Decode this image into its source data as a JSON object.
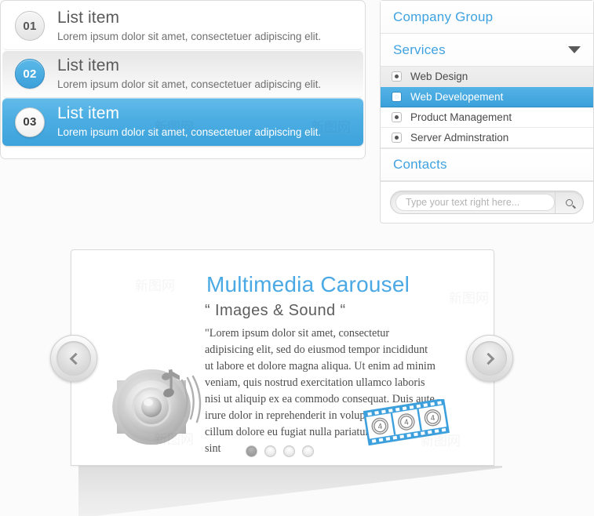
{
  "list_panel": {
    "items": [
      {
        "number": "01",
        "title": "List item",
        "description": "Lorem ipsum dolor sit amet, consectetuer adipiscing elit.",
        "state": "plain"
      },
      {
        "number": "02",
        "title": "List item",
        "description": "Lorem ipsum dolor sit amet, consectetuer adipiscing elit.",
        "state": "hover"
      },
      {
        "number": "03",
        "title": "List item",
        "description": "Lorem ipsum dolor sit amet, consectetuer adipiscing elit.",
        "state": "active"
      }
    ]
  },
  "menu_panel": {
    "company_group": "Company Group",
    "services": "Services",
    "contacts": "Contacts",
    "submenu": [
      {
        "label": "Web Design",
        "selected": false
      },
      {
        "label": "Web Developement",
        "selected": true
      },
      {
        "label": "Product Management",
        "selected": false
      },
      {
        "label": "Server Adminstration",
        "selected": false
      }
    ],
    "search": {
      "placeholder": "Type your text right here...",
      "value": "",
      "button_icon": "search-icon"
    },
    "dropdown_icon": "chevron-down-icon"
  },
  "carousel": {
    "title": "Multimedia Carousel",
    "subtitle": "“ Images & Sound “",
    "body": "\"Lorem ipsum dolor sit amet, consectetur adipisicing elit, sed do eiusmod tempor incididunt ut labore et dolore magna aliqua. Ut enim ad minim veniam, quis nostrud exercitation ullamco laboris nisi ut aliquip ex ea commodo consequat. Duis aute irure dolor in reprehenderit in voluptate velit esse cillum dolore eu fugiat nulla pariatur. Excepteur sint",
    "prev_icon": "chevron-left-icon",
    "next_icon": "chevron-right-icon",
    "speaker_icon": "speaker-music-icon",
    "film_icon": "film-strip-icon",
    "film_frame_label": "4",
    "dots": [
      {
        "active": true
      },
      {
        "active": false
      },
      {
        "active": false
      },
      {
        "active": false
      }
    ]
  },
  "colors": {
    "accent_blue": "#4aa9e4",
    "active_row_blue": "#4badE2",
    "text_gray": "#5a5a5a",
    "page_background": "#fbfbfb"
  },
  "watermarks": [
    "新图网",
    "新图网",
    "新图网",
    "新图网",
    "新图网",
    "新图网"
  ]
}
